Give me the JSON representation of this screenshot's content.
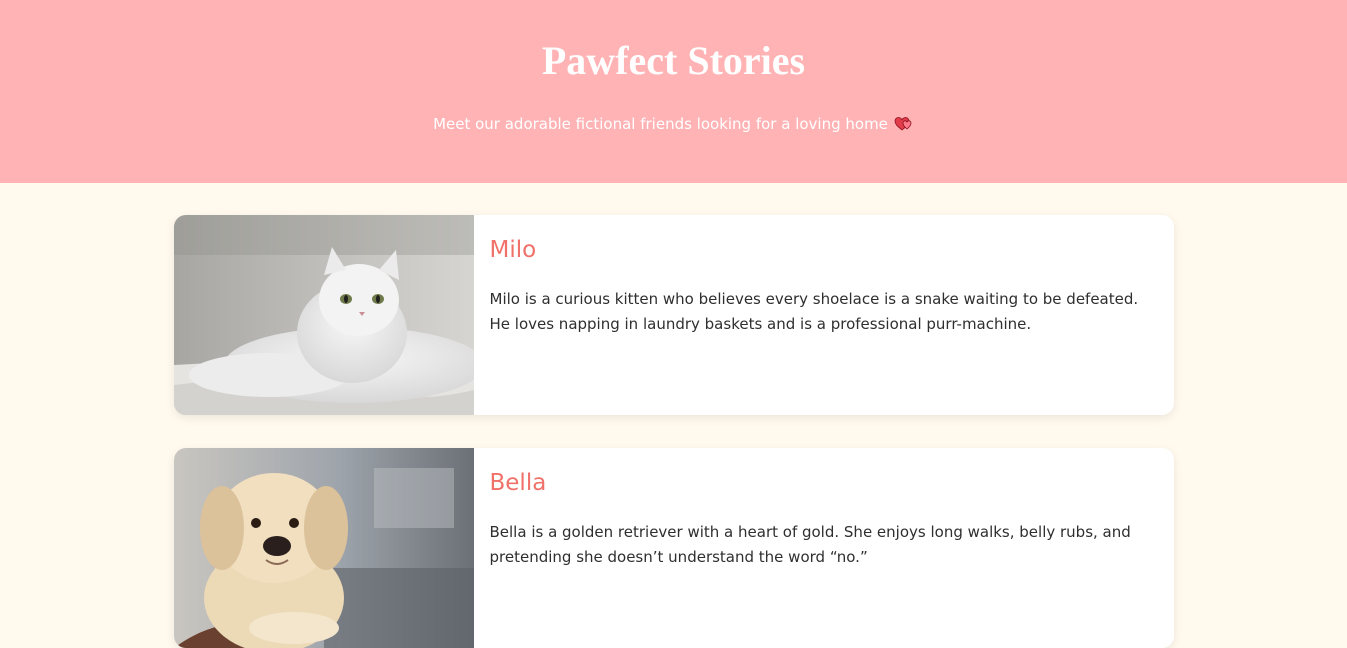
{
  "header": {
    "title": "Pawfect Stories",
    "subtitle": "Meet our adorable fictional friends looking for a loving home",
    "subtitle_icon": "hearts-icon",
    "background": "#ffb3b5"
  },
  "pets": [
    {
      "name": "Milo",
      "photo": "white-persian-cat-photo",
      "description": "Milo is a curious kitten who believes every shoelace is a snake waiting to be defeated. He loves napping in laundry baskets and is a professional purr-machine."
    },
    {
      "name": "Bella",
      "photo": "golden-retriever-puppy-photo",
      "description": "Bella is a golden retriever with a heart of gold. She enjoys long walks, belly rubs, and pretending she doesn’t understand the word “no.”"
    }
  ],
  "colors": {
    "page_background": "#fff9ee",
    "name_accent": "#f0706a"
  }
}
